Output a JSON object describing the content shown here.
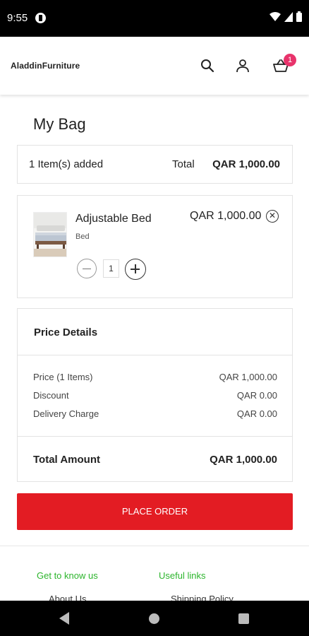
{
  "status_bar": {
    "time": "9:55"
  },
  "header": {
    "logo": "AladdinFurniture",
    "cart_count": "1"
  },
  "page": {
    "title": "My Bag"
  },
  "summary": {
    "items_added": "1 Item(s) added",
    "total_label": "Total",
    "total_value": "QAR 1,000.00"
  },
  "cart_item": {
    "name": "Adjustable Bed",
    "category": "Bed",
    "price": "QAR 1,000.00",
    "quantity": "1",
    "remove_glyph": "✕"
  },
  "price_details": {
    "title": "Price Details",
    "rows": [
      {
        "label": "Price (1 Items)",
        "value": "QAR 1,000.00"
      },
      {
        "label": "Discount",
        "value": "QAR 0.00"
      },
      {
        "label": "Delivery Charge",
        "value": "QAR 0.00"
      }
    ],
    "total_label": "Total Amount",
    "total_value": "QAR 1,000.00"
  },
  "actions": {
    "place_order": "PLACE ORDER"
  },
  "footer": {
    "col1_heading": "Get to know us",
    "col2_heading": "Useful links",
    "col1_link": "About Us",
    "col2_link": "Shipping Policy"
  },
  "colors": {
    "accent_red": "#e31c23",
    "footer_green": "#2db52d",
    "badge_pink": "#e8336b"
  }
}
